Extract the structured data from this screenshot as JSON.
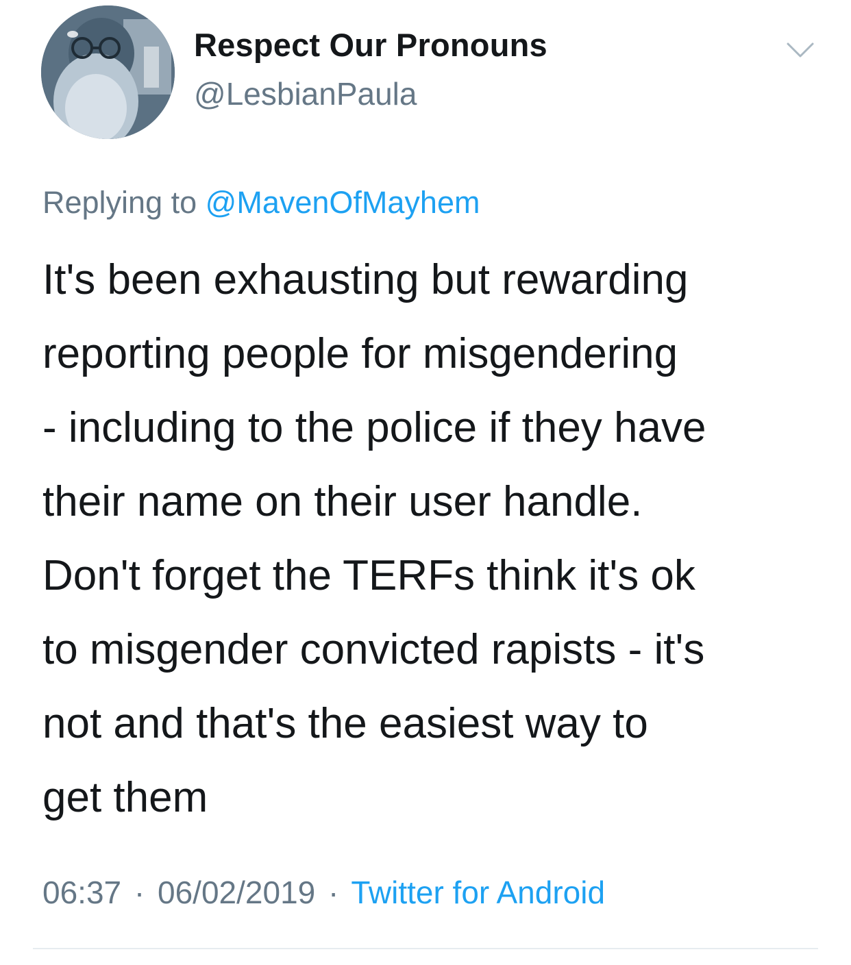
{
  "tweet": {
    "author": {
      "display_name": "Respect Our Pronouns",
      "handle": "@LesbianPaula"
    },
    "more_icon": "chevron-down-icon",
    "reply": {
      "prefix": "Replying to",
      "to_handle": "@MavenOfMayhem"
    },
    "text_lines": [
      "It's been exhausting but rewarding",
      "reporting people for misgendering",
      "- including to the police if they have",
      "their name on their user handle.",
      "Don't forget the TERFs think it's ok",
      "to misgender convicted rapists - it's",
      "not and that's the easiest way to",
      "get them"
    ],
    "meta": {
      "time": "06:37",
      "separator": "·",
      "date": "06/02/2019",
      "source": "Twitter for Android"
    }
  },
  "colors": {
    "text_primary": "#14171a",
    "text_secondary": "#657786",
    "link": "#1da1f2",
    "divider": "#e6ecf0"
  }
}
